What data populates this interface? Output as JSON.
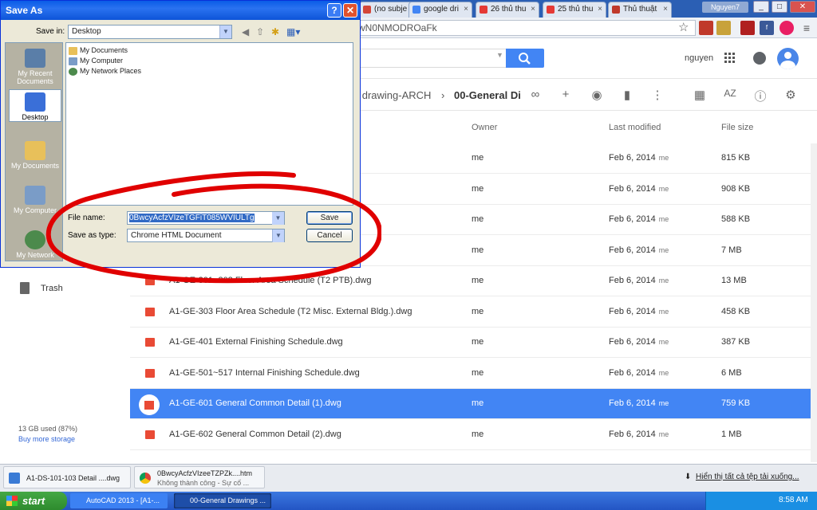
{
  "browser": {
    "tabs": [
      {
        "label": "(no subje",
        "color": "#d44638"
      },
      {
        "label": "google dri",
        "color": "#4285f4"
      },
      {
        "label": "26 thủ thu",
        "color": "#e53935"
      },
      {
        "label": "25 thủ thu",
        "color": "#e53935"
      },
      {
        "label": "Thủ thuật",
        "color": "#c0392b"
      }
    ],
    "user_chip": "Nguyen7",
    "url_fragment": "wN0NMODROaFk",
    "window_buttons": [
      "_",
      "□",
      "✕"
    ]
  },
  "drive": {
    "user_name": "nguyen",
    "breadcrumb": {
      "parent": "ct drawing-ARCH",
      "current": "00-General Di"
    },
    "columns": {
      "owner": "Owner",
      "modified": "Last modified",
      "size": "File size"
    },
    "rows": [
      {
        "name": "",
        "owner": "me",
        "modified": "Feb 6, 2014",
        "by": "me",
        "size": "815 KB",
        "selected": false
      },
      {
        "name": "",
        "owner": "me",
        "modified": "Feb 6, 2014",
        "by": "me",
        "size": "908 KB",
        "selected": false
      },
      {
        "name": "",
        "owner": "me",
        "modified": "Feb 6, 2014",
        "by": "me",
        "size": "588 KB",
        "selected": false
      },
      {
        "name": "",
        "owner": "me",
        "modified": "Feb 6, 2014",
        "by": "me",
        "size": "7 MB",
        "selected": false
      },
      {
        "name": "A1-GE-301~302 Floor Area Schedule (T2 PTB).dwg",
        "owner": "me",
        "modified": "Feb 6, 2014",
        "by": "me",
        "size": "13 MB",
        "selected": false
      },
      {
        "name": "A1-GE-303 Floor Area Schedule (T2 Misc. External Bldg.).dwg",
        "owner": "me",
        "modified": "Feb 6, 2014",
        "by": "me",
        "size": "458 KB",
        "selected": false
      },
      {
        "name": "A1-GE-401 External Finishing Schedule.dwg",
        "owner": "me",
        "modified": "Feb 6, 2014",
        "by": "me",
        "size": "387 KB",
        "selected": false
      },
      {
        "name": "A1-GE-501~517 Internal Finishing Schedule.dwg",
        "owner": "me",
        "modified": "Feb 6, 2014",
        "by": "me",
        "size": "6 MB",
        "selected": false
      },
      {
        "name": "A1-GE-601 General Common Detail (1).dwg",
        "owner": "me",
        "modified": "Feb 6, 2014",
        "by": "me",
        "size": "759 KB",
        "selected": true
      },
      {
        "name": "A1-GE-602 General Common Detail (2).dwg",
        "owner": "me",
        "modified": "Feb 6, 2014",
        "by": "me",
        "size": "1 MB",
        "selected": false
      }
    ],
    "nav": {
      "trash": "Trash"
    },
    "storage": {
      "used": "13 GB used (87%)",
      "buy": "Buy more storage"
    }
  },
  "downloads": {
    "items": [
      {
        "title": "A1-DS-101-103 Detail ....dwg",
        "status": ""
      },
      {
        "title": "0BwcyAcfzVIzeeTZPZk....htm",
        "status": "Không thành công - Sự cố ..."
      }
    ],
    "show_all": "Hiển thị tất cả tệp tải xuống..."
  },
  "taskbar": {
    "start": "start",
    "tasks": [
      "AutoCAD 2013 - [A1-...",
      "00-General Drawings ..."
    ],
    "clock": "8:58 AM"
  },
  "dialog": {
    "title": "Save As",
    "save_in_label": "Save in:",
    "save_in_value": "Desktop",
    "places": [
      "My Recent Documents",
      "Desktop",
      "My Documents",
      "My Computer",
      "My Network"
    ],
    "files": [
      "My Documents",
      "My Computer",
      "My Network Places"
    ],
    "file_name_label": "File name:",
    "file_name_value": "0BwcyAcfzVIzeTGFiT085WVIULTg",
    "save_type_label": "Save as type:",
    "save_type_value": "Chrome HTML Document",
    "save_button": "Save",
    "cancel_button": "Cancel",
    "help": "?",
    "close": "✕"
  },
  "colors": {
    "accent": "#4285f4",
    "annotation": "#e00000",
    "file_icon": "#e94a35"
  }
}
